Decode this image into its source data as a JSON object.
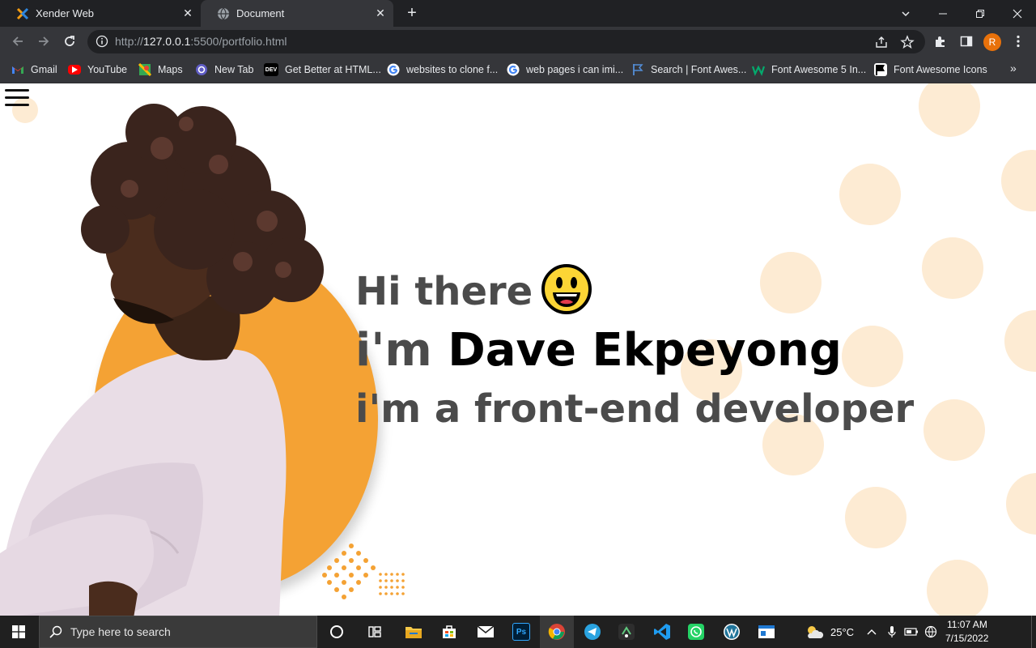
{
  "browser": {
    "tabs": [
      {
        "title": "Xender Web",
        "active": false
      },
      {
        "title": "Document",
        "active": true
      }
    ],
    "address": {
      "prefix": "http://",
      "host": "127.0.0.1",
      "rest": ":5500/portfolio.html"
    },
    "profile_initial": "R",
    "bookmarks": [
      {
        "label": "Gmail",
        "icon": "gmail-icon"
      },
      {
        "label": "YouTube",
        "icon": "youtube-icon"
      },
      {
        "label": "Maps",
        "icon": "maps-icon"
      },
      {
        "label": "New Tab",
        "icon": "new-tab-icon"
      },
      {
        "label": "Get Better at HTML...",
        "icon": "dev-icon"
      },
      {
        "label": "websites to clone f...",
        "icon": "google-icon"
      },
      {
        "label": "web pages i can imi...",
        "icon": "google-icon"
      },
      {
        "label": "Search | Font Awes...",
        "icon": "flag-icon"
      },
      {
        "label": "Font Awesome 5 In...",
        "icon": "w3-icon"
      },
      {
        "label": "Font Awesome Icons",
        "icon": "flag-icon"
      }
    ],
    "bookmark_dev_badge": "DEV"
  },
  "page": {
    "greeting": "Hi there",
    "intro_prefix": "i'm",
    "name": "Dave Ekpeyong",
    "role": "i'm a front-end developer",
    "accent_color": "#f4a234",
    "dot_color": "#fdebd3"
  },
  "taskbar": {
    "search_placeholder": "Type here to search",
    "weather": "25°C",
    "time": "11:07 AM",
    "date": "7/15/2022",
    "ps_label": "Ps"
  }
}
